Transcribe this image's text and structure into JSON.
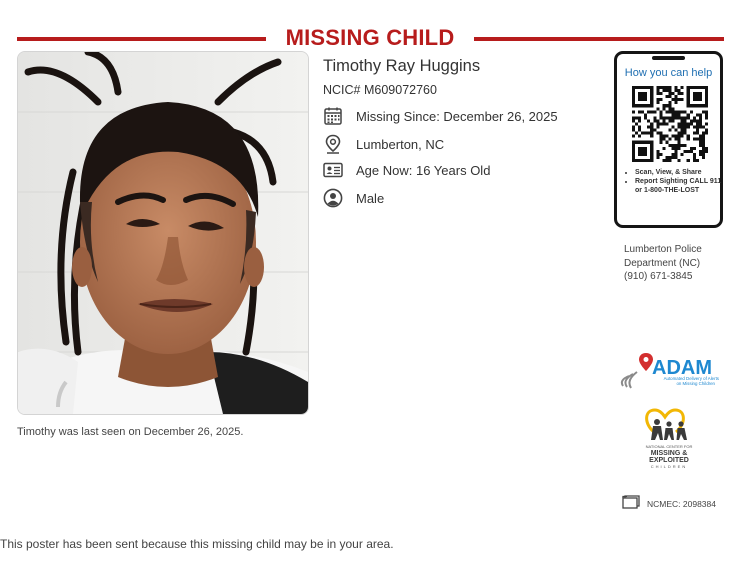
{
  "header": {
    "title": "MISSING CHILD",
    "accent_color": "#b71c1c"
  },
  "child": {
    "name": "Timothy Ray Huggins",
    "ncic": "NCIC# M609072760",
    "missing_since": "Missing Since: December 26, 2025",
    "location": "Lumberton, NC",
    "age_now": "Age Now: 16 Years Old",
    "sex": "Male",
    "last_seen": "Timothy was last seen on December 26, 2025."
  },
  "icons": {
    "missing_since": "calendar-icon",
    "location": "location-pin-icon",
    "age": "id-card-icon",
    "sex": "person-icon"
  },
  "phone_card": {
    "title": "How you can help",
    "bullets": [
      "Scan, View, & Share",
      "Report Sighting CALL 911 or 1-800-THE-LOST"
    ]
  },
  "agency": {
    "line1": "Lumberton Police",
    "line2": "Department (NC)",
    "phone": "(910) 671-3845"
  },
  "logos": {
    "adam": {
      "name": "ADAM",
      "tagline_1": "Automated Delivery of Alerts",
      "tagline_2": "on Missing Children"
    },
    "ncmec": {
      "line1": "NATIONAL CENTER FOR",
      "line2": "MISSING &",
      "line3": "EXPLOITED",
      "line4": "CHILDREN"
    }
  },
  "ncmec_case": "NCMEC: 2098384",
  "footer": "This poster has been sent because this missing child may be in your area."
}
